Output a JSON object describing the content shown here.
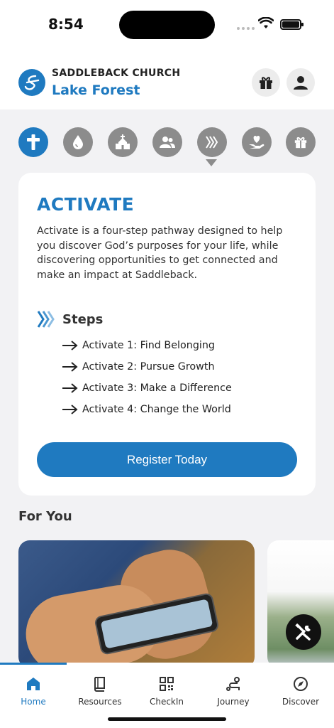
{
  "status_bar": {
    "time": "8:54"
  },
  "header": {
    "church_name": "SADDLEBACK CHURCH",
    "campus_name": "Lake Forest",
    "icons": [
      "gift-icon",
      "profile-icon"
    ]
  },
  "journey_icons": [
    "cross-icon",
    "water-drop-icon",
    "church-building-icon",
    "group-icon",
    "activate-chevrons-icon",
    "heart-hand-icon",
    "gift-icon"
  ],
  "card": {
    "title": "ACTIVATE",
    "description": "Activate is a four-step pathway designed to help you discover God’s purposes for your life, while discovering opportunities to get connected and make an impact at Saddleback.",
    "steps_title": "Steps",
    "steps": [
      "Activate 1: Find Belonging",
      "Activate 2: Pursue Growth",
      "Activate 3: Make a Difference",
      "Activate 4: Change the World"
    ],
    "button_label": "Register Today"
  },
  "for_you": {
    "title": "For You"
  },
  "tabs": [
    {
      "label": "Home",
      "icon": "home-icon",
      "active": true
    },
    {
      "label": "Resources",
      "icon": "book-icon",
      "active": false
    },
    {
      "label": "CheckIn",
      "icon": "qr-code-icon",
      "active": false
    },
    {
      "label": "Journey",
      "icon": "route-icon",
      "active": false
    },
    {
      "label": "Discover",
      "icon": "compass-icon",
      "active": false
    }
  ],
  "colors": {
    "accent": "#1f7ac0",
    "inactive_icon": "#8c8c8c"
  }
}
